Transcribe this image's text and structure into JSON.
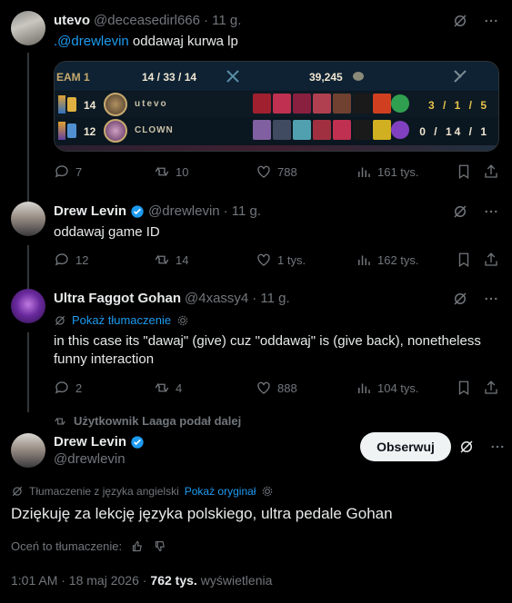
{
  "tweet1": {
    "name": "utevo",
    "handle": "@deceasedirl666",
    "time": "· 11 g.",
    "mention": ".@drewlevin",
    "text": " oddawaj kurwa lp",
    "scoreboard": {
      "team": "EAM 1",
      "kda_total": "14  /  33  /  14",
      "gold": "39,245",
      "rows": [
        {
          "level": "14",
          "name": "utevo",
          "kda": "3 / 1 / 5"
        },
        {
          "level": "12",
          "name": "CLOWN",
          "kda": "0 / 14 / 1"
        }
      ]
    },
    "actions": {
      "replies": "7",
      "retweets": "10",
      "likes": "788",
      "views": "161 tys."
    }
  },
  "tweet2": {
    "name": "Drew Levin",
    "handle": "@drewlevin",
    "time": "· 11 g.",
    "text": "oddawaj game ID",
    "actions": {
      "replies": "12",
      "retweets": "14",
      "likes": "1 tys.",
      "views": "162 tys."
    }
  },
  "tweet3": {
    "name": "Ultra Faggot Gohan",
    "handle": "@4xassy4",
    "time": "· 11 g.",
    "translate_label": "Pokaż tłumaczenie",
    "text": "in this case its \"dawaj\" (give) cuz \"oddawaj\" is (give back), nonetheless funny interaction",
    "actions": {
      "replies": "2",
      "retweets": "4",
      "likes": "888",
      "views": "104 tys."
    }
  },
  "main": {
    "reposted_by": "Użytkownik Laaga podał dalej",
    "name": "Drew Levin",
    "handle": "@drewlevin",
    "follow_label": "Obserwuj",
    "translated_from": "Tłumaczenie z języka angielski",
    "show_original": "Pokaż oryginał",
    "text": "Dziękuję za lekcję języka polskiego, ultra pedale Gohan",
    "rate_label": "Oceń to tłumaczenie:",
    "time": "1:01 AM · 18 maj 2026 ·",
    "views_count": "762 tys.",
    "views_label": "wyświetlenia"
  },
  "colors": {
    "accent": "#1d9bf0",
    "verified": "#1d9bf0",
    "divider": "#2f3336",
    "muted": "#71767b"
  }
}
